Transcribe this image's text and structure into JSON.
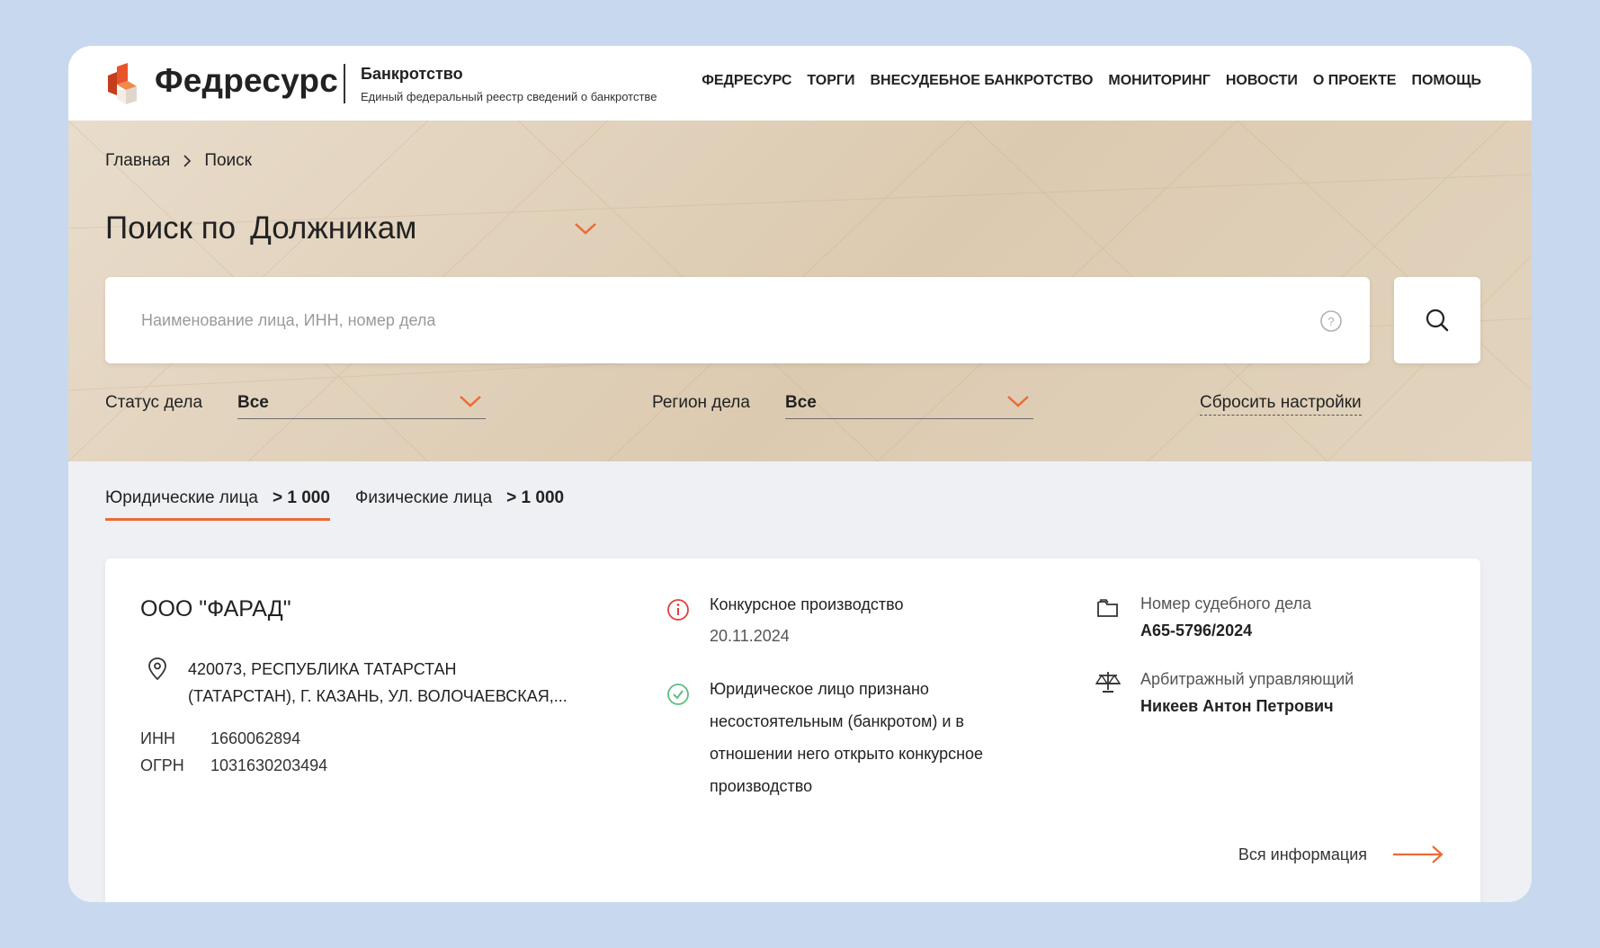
{
  "header": {
    "brand": "Федресурс",
    "sub_title": "Банкротство",
    "sub_desc": "Единый федеральный реестр сведений о банкротстве",
    "nav": [
      "ФЕДРЕСУРС",
      "ТОРГИ",
      "ВНЕСУДЕБНОЕ БАНКРОТСТВО",
      "МОНИТОРИНГ",
      "НОВОСТИ",
      "О ПРОЕКТЕ",
      "ПОМОЩЬ"
    ]
  },
  "breadcrumb": {
    "home": "Главная",
    "current": "Поиск"
  },
  "search": {
    "title_prefix": "Поиск по",
    "title_selected": "Должникам",
    "placeholder": "Наименование лица, ИНН, номер дела"
  },
  "filters": {
    "status_label": "Статус дела",
    "status_value": "Все",
    "region_label": "Регион дела",
    "region_value": "Все",
    "reset_label": "Сбросить настройки"
  },
  "tabs": [
    {
      "label": "Юридические лица",
      "count": "> 1 000",
      "active": true
    },
    {
      "label": "Физические лица",
      "count": "> 1 000",
      "active": false
    }
  ],
  "result": {
    "name": "ООО \"ФАРАД\"",
    "address_line1": "420073, РЕСПУБЛИКА ТАТАРСТАН",
    "address_line2": "(ТАТАРСТАН), Г. КАЗАНЬ, УЛ. ВОЛОЧАЕВСКАЯ,...",
    "inn_label": "ИНН",
    "inn": "1660062894",
    "ogrn_label": "ОГРН",
    "ogrn": "1031630203494",
    "status1_text": "Конкурсное производство",
    "status1_date": "20.11.2024",
    "status2_line1": "Юридическое лицо признано",
    "status2_line2": "несостоятельным (банкротом) и в",
    "status2_line3": "отношении него открыто конкурсное",
    "status2_line4": "производство",
    "case_label": "Номер судебного дела",
    "case_number": "А65-5796/2024",
    "manager_label": "Арбитражный управляющий",
    "manager_name": "Никеев Антон Петрович",
    "all_info": "Вся информация"
  },
  "colors": {
    "accent": "#ec6b36",
    "error": "#e0403a",
    "success": "#5bbd82",
    "page_bg": "#c8d8ef"
  }
}
